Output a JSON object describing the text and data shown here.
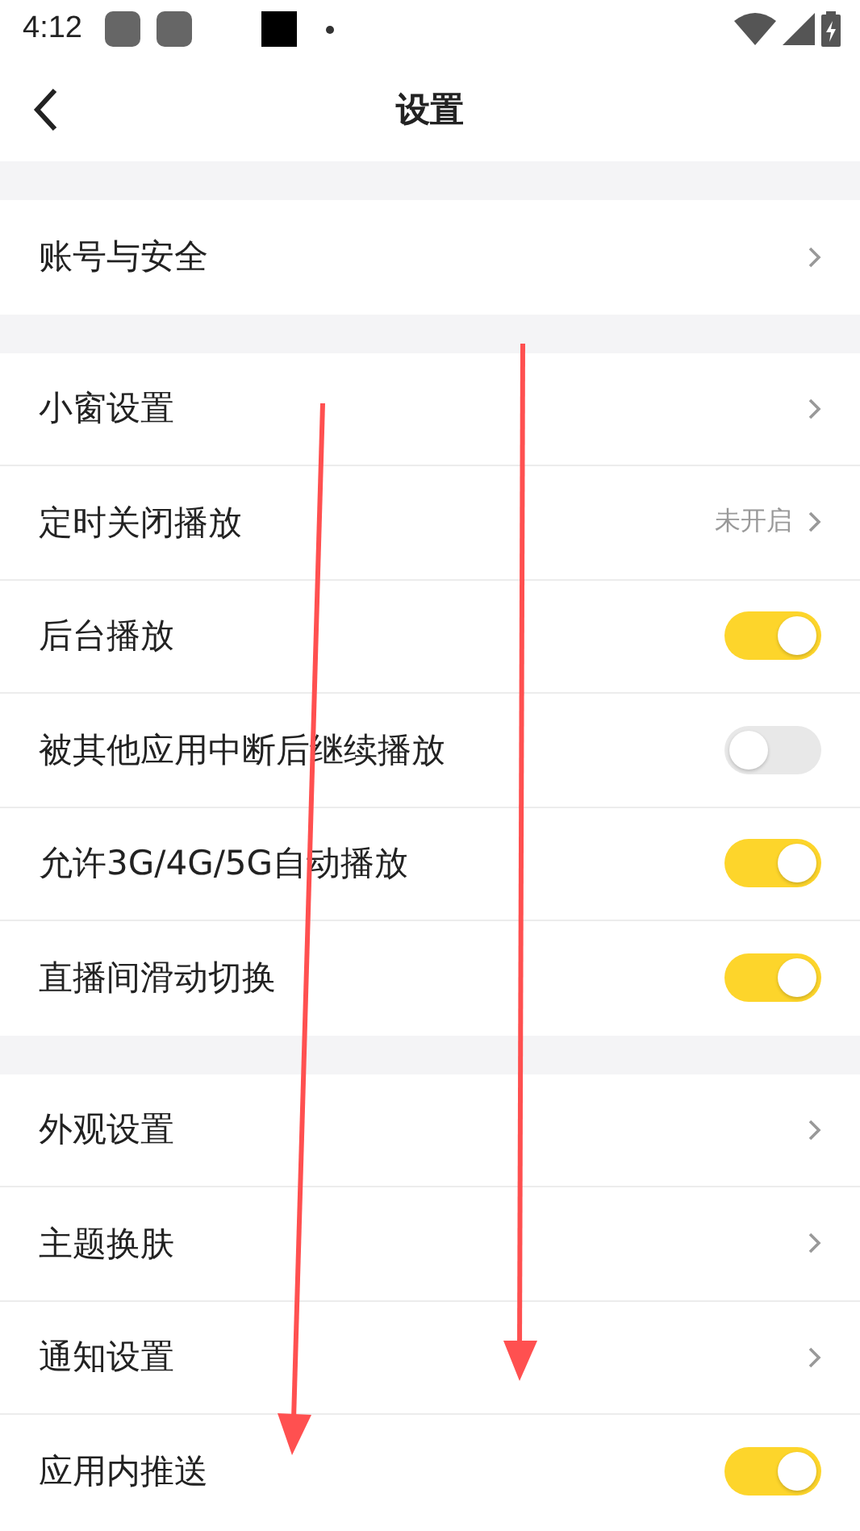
{
  "status_bar": {
    "time": "4:12"
  },
  "header": {
    "title": "设置"
  },
  "sections": [
    {
      "rows": [
        {
          "kind": "link",
          "label": "账号与安全"
        }
      ]
    },
    {
      "rows": [
        {
          "kind": "link",
          "label": "小窗设置"
        },
        {
          "kind": "link",
          "label": "定时关闭播放",
          "value": "未开启"
        },
        {
          "kind": "toggle",
          "label": "后台播放",
          "on": true
        },
        {
          "kind": "toggle",
          "label": "被其他应用中断后继续播放",
          "on": false
        },
        {
          "kind": "toggle",
          "label": "允许3G/4G/5G自动播放",
          "on": true
        },
        {
          "kind": "toggle",
          "label": "直播间滑动切换",
          "on": true
        }
      ]
    },
    {
      "rows": [
        {
          "kind": "link",
          "label": "外观设置"
        },
        {
          "kind": "link",
          "label": "主题换肤"
        },
        {
          "kind": "link",
          "label": "通知设置"
        },
        {
          "kind": "toggle",
          "label": "应用内推送",
          "on": true
        }
      ]
    }
  ]
}
